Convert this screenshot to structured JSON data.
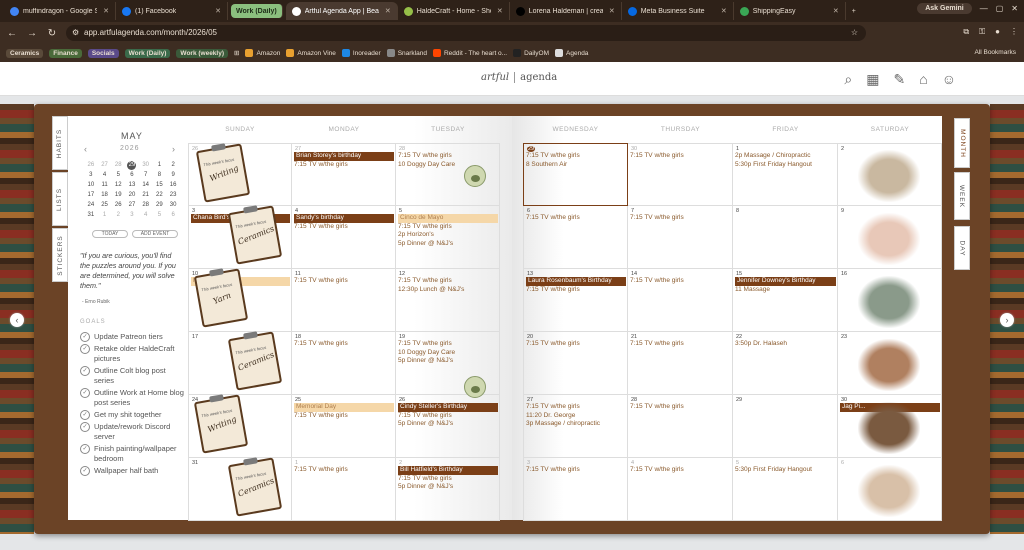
{
  "browser": {
    "tabs": [
      {
        "label": "muffindragon - Google S",
        "color": "#4285f4",
        "active": false
      },
      {
        "label": "(1) Facebook",
        "color": "#1877f2",
        "active": false
      },
      {
        "label": "Work (Daily)",
        "group": true
      },
      {
        "label": "Artful Agenda App | Beau",
        "color": "#ffffff",
        "active": true
      },
      {
        "label": "HaldeCraft - Home - Shop",
        "color": "#96bf48",
        "active": false
      },
      {
        "label": "Lorena Haldeman | creati",
        "color": "#000000",
        "active": false
      },
      {
        "label": "Meta Business Suite",
        "color": "#0668e1",
        "active": false
      },
      {
        "label": "ShippingEasy",
        "color": "#3aa655",
        "active": false
      }
    ],
    "new_tab": "+",
    "gemini": "Ask Gemini",
    "url": "app.artfulagenda.com/month/2026/05",
    "bookmarks": [
      {
        "label": "Ceramics",
        "chip": "#5a4a3a"
      },
      {
        "label": "Finance",
        "chip": "#4a6a3a"
      },
      {
        "label": "Socials",
        "chip": "#5a4a8a"
      },
      {
        "label": "Work (Daily)",
        "chip": "#3a6a4a"
      },
      {
        "label": "Work (weekly)",
        "chip": "#3a5a3a"
      },
      {
        "label": "Amazon",
        "icon": "#e8a030"
      },
      {
        "label": "Amazon Vine",
        "icon": "#e8a030"
      },
      {
        "label": "Inoreader",
        "icon": "#1e88e5"
      },
      {
        "label": "Snarkland",
        "icon": "#888888"
      },
      {
        "label": "Reddit - The heart o...",
        "icon": "#ff4500"
      },
      {
        "label": "DailyOM",
        "icon": "#222222"
      },
      {
        "label": "Agenda",
        "icon": "#dddddd"
      }
    ],
    "all_bookmarks": "All Bookmarks"
  },
  "app": {
    "logo_part1": "artful",
    "logo_part2": "agenda"
  },
  "left_tabs": [
    "HABITS",
    "LISTS",
    "STICKERS"
  ],
  "right_tabs": [
    "MONTH",
    "WEEK",
    "DAY"
  ],
  "mini_calendar": {
    "month": "MAY",
    "year": "2026",
    "weeks": [
      [
        "26",
        "27",
        "28",
        "29",
        "30",
        "1",
        "2"
      ],
      [
        "3",
        "4",
        "5",
        "6",
        "7",
        "8",
        "9"
      ],
      [
        "10",
        "11",
        "12",
        "13",
        "14",
        "15",
        "16"
      ],
      [
        "17",
        "18",
        "19",
        "20",
        "21",
        "22",
        "23"
      ],
      [
        "24",
        "25",
        "26",
        "27",
        "28",
        "29",
        "30"
      ],
      [
        "31",
        "1",
        "2",
        "3",
        "4",
        "5",
        "6"
      ]
    ],
    "today_label": "TODAY",
    "add_event_label": "ADD EVENT"
  },
  "quote": {
    "text": "\"If you are curious, you'll find the puzzles around you. If you are determined, you will solve them.\"",
    "author": "- Erno Rubik"
  },
  "goals": {
    "title": "GOALS",
    "items": [
      "Update Patreon tiers",
      "Retake older HaldeCraft pictures",
      "Outline Colt blog post series",
      "Outline Work at Home blog post series",
      "Get my shit together",
      "Update/rework Discord server",
      "Finish painting/wallpaper bedroom",
      "Wallpaper half bath"
    ]
  },
  "day_headers": [
    "SUNDAY",
    "MONDAY",
    "TUESDAY",
    "WEDNESDAY",
    "THURSDAY",
    "FRIDAY",
    "SATURDAY"
  ],
  "weeks": [
    {
      "days": [
        {
          "d": "26",
          "dim": true,
          "events": []
        },
        {
          "d": "27",
          "dim": true,
          "events": [
            {
              "t": "Brian Storey's birthday",
              "band": true
            },
            {
              "t": "7:15 TV w/the girls"
            }
          ]
        },
        {
          "d": "28",
          "dim": true,
          "events": [
            {
              "t": "7:15 TV w/the girls"
            },
            {
              "t": "10 Doggy Day Care"
            }
          ]
        },
        {
          "d": "29",
          "dim": true,
          "sel": true,
          "events": [
            {
              "t": "7:15 TV w/the girls"
            },
            {
              "t": "8 Southern Air"
            }
          ]
        },
        {
          "d": "30",
          "dim": true,
          "events": [
            {
              "t": "7:15 TV w/the girls"
            }
          ]
        },
        {
          "d": "1",
          "events": [
            {
              "t": "2p Massage / Chiropractic"
            },
            {
              "t": "5:30p First Friday Hangout"
            }
          ]
        },
        {
          "d": "2",
          "events": []
        }
      ]
    },
    {
      "days": [
        {
          "d": "3",
          "events": [
            {
              "t": "Chana Bird's birthday",
              "band": true
            }
          ]
        },
        {
          "d": "4",
          "events": [
            {
              "t": "Sandy's birthday",
              "band": true
            },
            {
              "t": "7:15 TV w/the girls"
            }
          ]
        },
        {
          "d": "5",
          "events": [
            {
              "t": "Cinco de Mayo",
              "band": true,
              "light": true
            },
            {
              "t": "7:15 TV w/the girls"
            },
            {
              "t": "2p Horizon's"
            },
            {
              "t": "5p Dinner @ N&J's"
            }
          ]
        },
        {
          "d": "6",
          "events": [
            {
              "t": "7:15 TV w/the girls"
            }
          ]
        },
        {
          "d": "7",
          "events": [
            {
              "t": "7:15 TV w/the girls"
            }
          ]
        },
        {
          "d": "8",
          "events": []
        },
        {
          "d": "9",
          "events": []
        }
      ]
    },
    {
      "days": [
        {
          "d": "10",
          "events": [
            {
              "t": "Mother's Day",
              "band": true,
              "light": true
            }
          ]
        },
        {
          "d": "11",
          "events": [
            {
              "t": "7:15 TV w/the girls"
            }
          ]
        },
        {
          "d": "12",
          "events": [
            {
              "t": "7:15 TV w/the girls"
            },
            {
              "t": "12:30p Lunch @ N&J's"
            }
          ]
        },
        {
          "d": "13",
          "events": [
            {
              "t": "Laura Rosenbaum's Birthday",
              "band": true
            },
            {
              "t": "7:15 TV w/the girls"
            }
          ]
        },
        {
          "d": "14",
          "events": [
            {
              "t": "7:15 TV w/the girls"
            }
          ]
        },
        {
          "d": "15",
          "events": [
            {
              "t": "Jennifer Downey's Birthday",
              "band": true
            },
            {
              "t": "11 Massage"
            }
          ]
        },
        {
          "d": "16",
          "events": []
        }
      ]
    },
    {
      "days": [
        {
          "d": "17",
          "events": []
        },
        {
          "d": "18",
          "events": [
            {
              "t": "7:15 TV w/the girls"
            }
          ]
        },
        {
          "d": "19",
          "events": [
            {
              "t": "7:15 TV w/the girls"
            },
            {
              "t": "10 Doggy Day Care"
            },
            {
              "t": "5p Dinner @ N&J's"
            }
          ]
        },
        {
          "d": "20",
          "events": [
            {
              "t": "7:15 TV w/the girls"
            }
          ]
        },
        {
          "d": "21",
          "events": [
            {
              "t": "7:15 TV w/the girls"
            }
          ]
        },
        {
          "d": "22",
          "events": [
            {
              "t": "3:50p Dr. Halaseh"
            }
          ]
        },
        {
          "d": "23",
          "events": []
        }
      ]
    },
    {
      "days": [
        {
          "d": "24",
          "events": []
        },
        {
          "d": "25",
          "events": [
            {
              "t": "Memorial Day",
              "band": true,
              "light": true
            },
            {
              "t": "7:15 TV w/the girls"
            }
          ]
        },
        {
          "d": "26",
          "events": [
            {
              "t": "Cindy Steller's Birthday",
              "band": true
            },
            {
              "t": "7:15 TV w/the girls"
            },
            {
              "t": "5p Dinner @ N&J's"
            }
          ]
        },
        {
          "d": "27",
          "events": [
            {
              "t": "7:15 TV w/the girls"
            },
            {
              "t": "11:20 Dr. George"
            },
            {
              "t": "3p Massage / chiropractic"
            }
          ]
        },
        {
          "d": "28",
          "events": [
            {
              "t": "7:15 TV w/the girls"
            }
          ]
        },
        {
          "d": "29",
          "events": []
        },
        {
          "d": "30",
          "events": [
            {
              "t": "Jag Pi...",
              "band": true
            }
          ]
        }
      ]
    },
    {
      "days": [
        {
          "d": "31",
          "events": []
        },
        {
          "d": "1",
          "dim": true,
          "events": [
            {
              "t": "7:15 TV w/the girls"
            }
          ]
        },
        {
          "d": "2",
          "dim": true,
          "events": [
            {
              "t": "Bill Hatfield's Birthday",
              "band": true
            },
            {
              "t": "7:15 TV w/the girls"
            },
            {
              "t": "5p Dinner @ N&J's"
            }
          ]
        },
        {
          "d": "3",
          "dim": true,
          "events": [
            {
              "t": "7:15 TV w/the girls"
            }
          ]
        },
        {
          "d": "4",
          "dim": true,
          "events": [
            {
              "t": "7:15 TV w/the girls"
            }
          ]
        },
        {
          "d": "5",
          "dim": true,
          "events": [
            {
              "t": "5:30p First Friday Hangout"
            }
          ]
        },
        {
          "d": "6",
          "dim": true,
          "events": []
        }
      ]
    }
  ],
  "focus_stickers": {
    "caption": "This week's focus",
    "words": [
      "Writing",
      "Ceramics",
      "Yarn",
      "Ceramics",
      "Writing",
      "Ceramics"
    ]
  },
  "saturday_images": [
    {
      "name": "typewriter-sticker",
      "color": "#c9b8a0"
    },
    {
      "name": "ceramic-cups-sticker",
      "color": "#e8c8b8"
    },
    {
      "name": "yarn-balls-sticker",
      "color": "#8a9a8a"
    },
    {
      "name": "pottery-tools-sticker",
      "color": "#b08060"
    },
    {
      "name": "vintage-typewriter-sticker",
      "color": "#7a5a40"
    },
    {
      "name": "art-desk-sticker",
      "color": "#d8c0a8"
    }
  ]
}
